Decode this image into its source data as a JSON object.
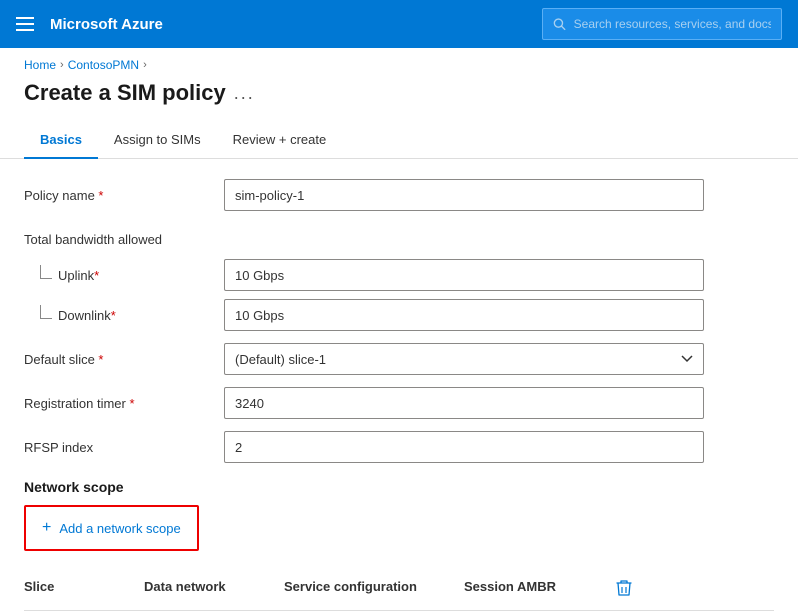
{
  "navbar": {
    "title": "Microsoft Azure",
    "search_placeholder": "Search resources, services, and docs"
  },
  "breadcrumb": {
    "home": "Home",
    "parent": "ContosoPMN"
  },
  "page": {
    "title": "Create a SIM policy",
    "dots": "..."
  },
  "tabs": [
    {
      "id": "basics",
      "label": "Basics",
      "active": true
    },
    {
      "id": "assign-to-sims",
      "label": "Assign to SIMs",
      "active": false
    },
    {
      "id": "review-create",
      "label": "Review + create",
      "active": false
    }
  ],
  "form": {
    "policy_name_label": "Policy name",
    "policy_name_required": " *",
    "policy_name_value": "sim-policy-1",
    "bandwidth_label": "Total bandwidth allowed",
    "uplink_label": "Uplink",
    "uplink_required": " *",
    "uplink_value": "10 Gbps",
    "downlink_label": "Downlink",
    "downlink_required": " *",
    "downlink_value": "10 Gbps",
    "default_slice_label": "Default slice",
    "default_slice_required": " *",
    "default_slice_value": "(Default) slice-1",
    "registration_timer_label": "Registration timer",
    "registration_timer_required": " *",
    "registration_timer_value": "3240",
    "rfsp_index_label": "RFSP index",
    "rfsp_index_value": "2"
  },
  "network_scope": {
    "heading": "Network scope",
    "add_button": "+ Add a network scope"
  },
  "table": {
    "col_slice": "Slice",
    "col_data_network": "Data network",
    "col_service_config": "Service configuration",
    "col_session_ambr": "Session AMBR"
  }
}
